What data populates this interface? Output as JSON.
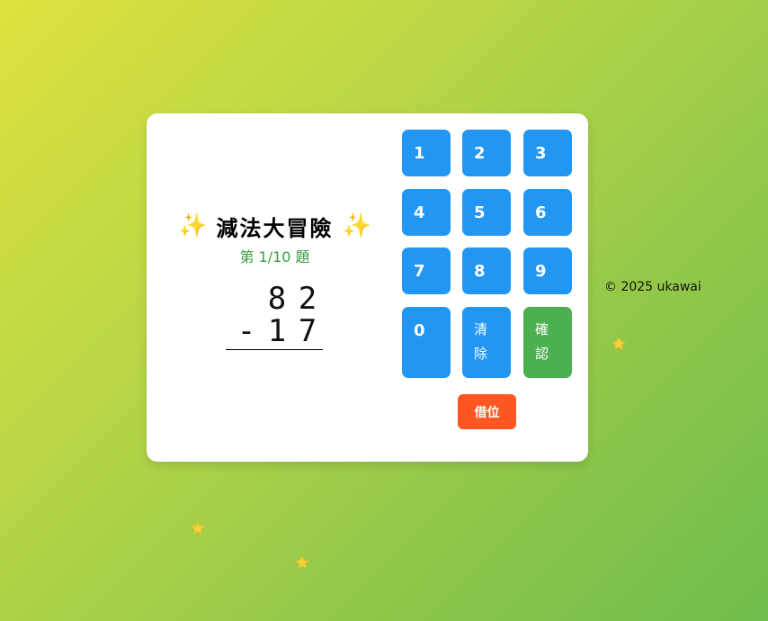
{
  "game": {
    "title": "減法大冒險",
    "sparkle_left": "✨",
    "sparkle_right": "✨",
    "progress": "第 1/10 題",
    "problem": {
      "top_digits": [
        "8",
        "2"
      ],
      "operator": "-",
      "bottom_digits": [
        "1",
        "7"
      ]
    }
  },
  "keypad": {
    "keys": [
      {
        "label": "1"
      },
      {
        "label": "2"
      },
      {
        "label": "3"
      },
      {
        "label": "4"
      },
      {
        "label": "5"
      },
      {
        "label": "6"
      },
      {
        "label": "7"
      },
      {
        "label": "8"
      },
      {
        "label": "9"
      },
      {
        "label": "0"
      }
    ],
    "clear_label": [
      "清",
      "除"
    ],
    "confirm_label": [
      "確",
      "認"
    ],
    "borrow_label": "借位",
    "colors": {
      "number": "#2196f3",
      "confirm": "#4caf50",
      "borrow": "#ff5722"
    }
  },
  "footer": {
    "copyright": "© 2025 ukawai"
  },
  "decorations": {
    "star_icon": "star-icon",
    "star_color": "#f9d13a"
  }
}
